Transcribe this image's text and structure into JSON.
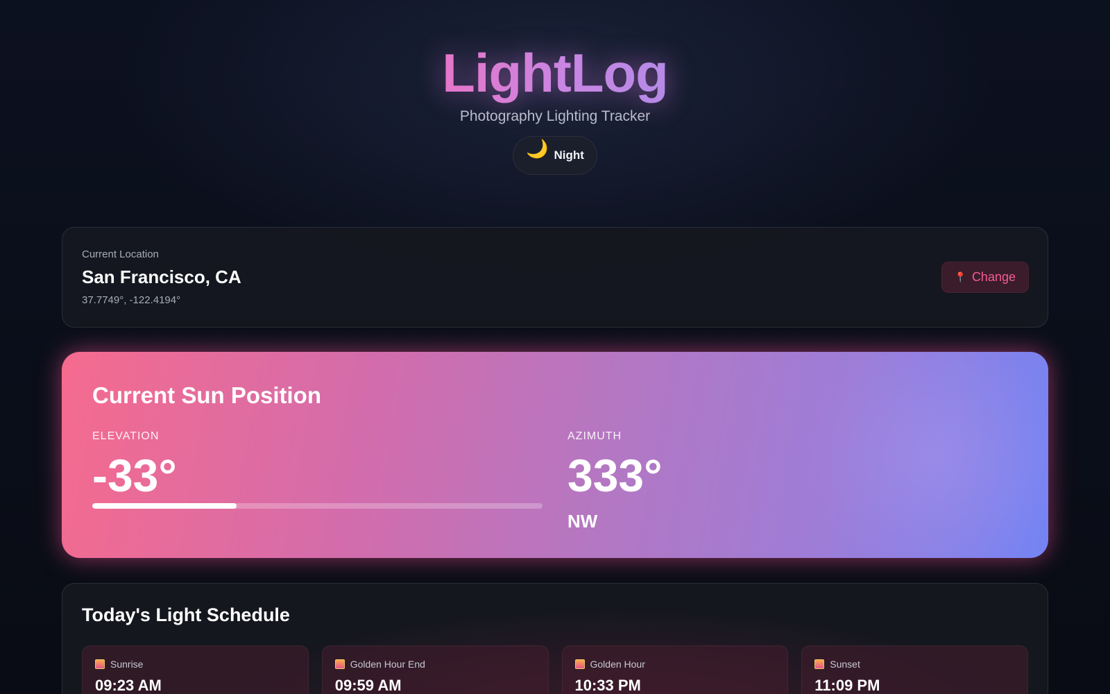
{
  "header": {
    "title": "LightLog",
    "subtitle": "Photography Lighting Tracker",
    "mode": {
      "icon": "moon-icon",
      "glyph": "🌙",
      "label": "Night"
    }
  },
  "location": {
    "label": "Current Location",
    "name": "San Francisco, CA",
    "coords": "37.7749°, -122.4194°",
    "change_button": {
      "icon": "pin-icon",
      "glyph": "📍",
      "label": "Change"
    }
  },
  "sun": {
    "title": "Current Sun Position",
    "elevation": {
      "label": "ELEVATION",
      "value": "-33°",
      "progress_fraction": 0.32
    },
    "azimuth": {
      "label": "AZIMUTH",
      "value": "333°",
      "direction": "NW"
    }
  },
  "schedule": {
    "title": "Today's Light Schedule",
    "items": [
      {
        "icon": "sunrise-icon",
        "name": "Sunrise",
        "time": "09:23 AM"
      },
      {
        "icon": "golden-hour-icon",
        "name": "Golden Hour End",
        "time": "09:59 AM"
      },
      {
        "icon": "golden-hour-icon",
        "name": "Golden Hour",
        "time": "10:33 PM"
      },
      {
        "icon": "sunset-icon",
        "name": "Sunset",
        "time": "11:09 PM"
      }
    ]
  },
  "colors": {
    "accent_pink": "#f35c8f",
    "logo_gradient_start": "#e676c9",
    "logo_gradient_end": "#b48ae6",
    "sun_card_start": "#f56b8e",
    "sun_card_end": "#7484f4"
  }
}
